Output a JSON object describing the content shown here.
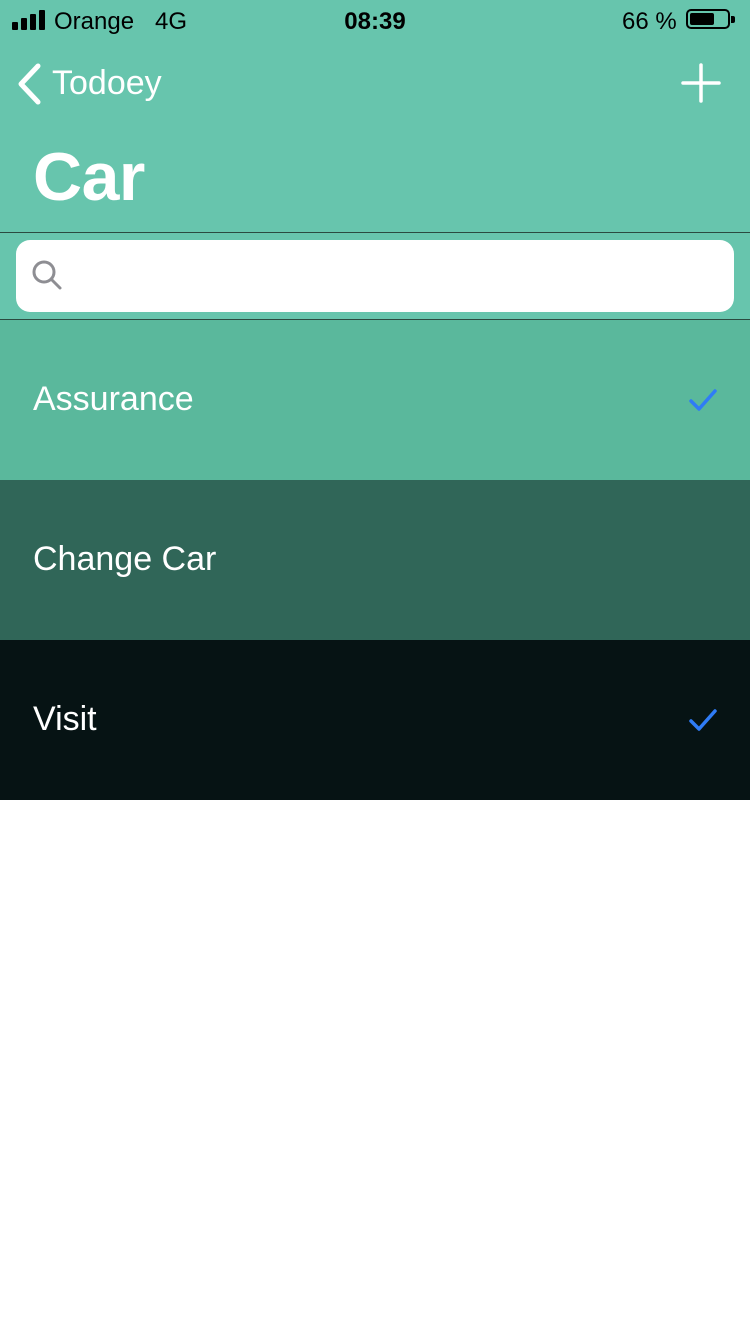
{
  "status_bar": {
    "carrier": "Orange",
    "network": "4G",
    "time": "08:39",
    "battery_percent": "66 %",
    "battery_level": 0.66,
    "signal_bars": 4
  },
  "nav": {
    "back_label": "Todoey",
    "back_icon": "chevron-left-icon",
    "add_icon": "plus-icon",
    "title": "Car"
  },
  "search": {
    "placeholder": "",
    "value": "",
    "icon": "search-icon"
  },
  "items": [
    {
      "label": "Assurance",
      "done": true,
      "color": "#5ab89c"
    },
    {
      "label": "Change Car",
      "done": false,
      "color": "#306658"
    },
    {
      "label": "Visit",
      "done": true,
      "color": "#061314"
    }
  ],
  "colors": {
    "nav_background": "#67c5ad",
    "checkmark": "#2f7cf6",
    "text": "#ffffff"
  }
}
